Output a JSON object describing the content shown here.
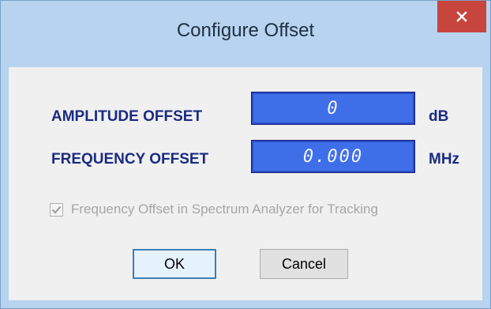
{
  "window": {
    "title": "Configure Offset",
    "close_label": "close",
    "colors": {
      "frame": "#b7d3ef",
      "close_button": "#c7453c",
      "value_box": "#3f6fe8",
      "label_text": "#1a2b80"
    }
  },
  "fields": {
    "amplitude": {
      "label": "AMPLITUDE OFFSET",
      "value": "0",
      "unit": "dB"
    },
    "frequency": {
      "label": "FREQUENCY OFFSET",
      "value": "0.000",
      "unit": "MHz"
    }
  },
  "tracking_option": {
    "label": "Frequency Offset in Spectrum Analyzer for Tracking",
    "checked": true,
    "enabled": false
  },
  "buttons": {
    "ok_label": "OK",
    "cancel_label": "Cancel"
  },
  "icons": {
    "close": "close-icon",
    "check": "checkmark-icon"
  }
}
